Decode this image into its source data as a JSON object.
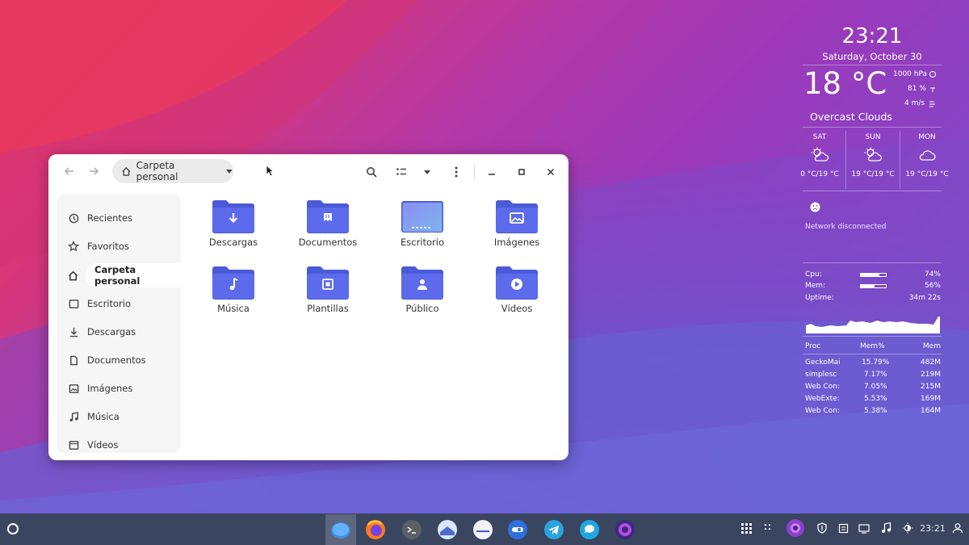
{
  "window": {
    "path_label": "Carpeta personal"
  },
  "sidebar": {
    "items": [
      {
        "label": "Recientes"
      },
      {
        "label": "Favoritos"
      },
      {
        "label": "Carpeta personal"
      },
      {
        "label": "Escritorio"
      },
      {
        "label": "Descargas"
      },
      {
        "label": "Documentos"
      },
      {
        "label": "Imágenes"
      },
      {
        "label": "Música"
      },
      {
        "label": "Vídeos"
      }
    ]
  },
  "folders": [
    {
      "label": "Descargas",
      "icon": "download-icon"
    },
    {
      "label": "Documentos",
      "icon": "document-icon"
    },
    {
      "label": "Escritorio",
      "icon": "desktop-icon"
    },
    {
      "label": "Imágenes",
      "icon": "image-icon"
    },
    {
      "label": "Música",
      "icon": "music-icon"
    },
    {
      "label": "Plantillas",
      "icon": "template-icon"
    },
    {
      "label": "Público",
      "icon": "person-icon"
    },
    {
      "label": "Vídeos",
      "icon": "play-icon"
    }
  ],
  "widget": {
    "time": "23:21",
    "date": "Saturday, October 30",
    "temperature": "18 °C",
    "pressure": "1000 hPa",
    "humidity": "81 %",
    "wind": "4 m/s",
    "condition": "Overcast Clouds",
    "forecast": [
      {
        "day": "SAT",
        "temps": "0 °C/19 °C"
      },
      {
        "day": "SUN",
        "temps": "19 °C/19 °C"
      },
      {
        "day": "MON",
        "temps": "19 °C/19 °C"
      }
    ],
    "network_status": "Network disconnected",
    "cpu_label": "Cpu:",
    "cpu_value": "74%",
    "cpu_fraction": 0.74,
    "mem_label": "Mem:",
    "mem_value": "56%",
    "mem_fraction": 0.56,
    "uptime_label": "Uptime:",
    "uptime_value": "34m 22s",
    "proc_headers": [
      "Proc",
      "Mem%",
      "Mem"
    ],
    "processes": [
      {
        "name": "GeckoMai",
        "mem_pct": "15.79%",
        "mem": "482M"
      },
      {
        "name": "simplesc",
        "mem_pct": "7.17%",
        "mem": "219M"
      },
      {
        "name": "Web Con:",
        "mem_pct": "7.05%",
        "mem": "215M"
      },
      {
        "name": "WebExte:",
        "mem_pct": "5.53%",
        "mem": "169M"
      },
      {
        "name": "Web Con:",
        "mem_pct": "5.38%",
        "mem": "164M"
      }
    ]
  },
  "taskbar": {
    "clock": "23:21",
    "apps": [
      "files",
      "firefox",
      "terminal",
      "mail",
      "chat",
      "settings",
      "telegram",
      "messages",
      "media"
    ]
  },
  "colors": {
    "folder": "#5b6bec",
    "folder_tab": "#4b5ad8",
    "accent_purple": "#8a3fd1"
  }
}
